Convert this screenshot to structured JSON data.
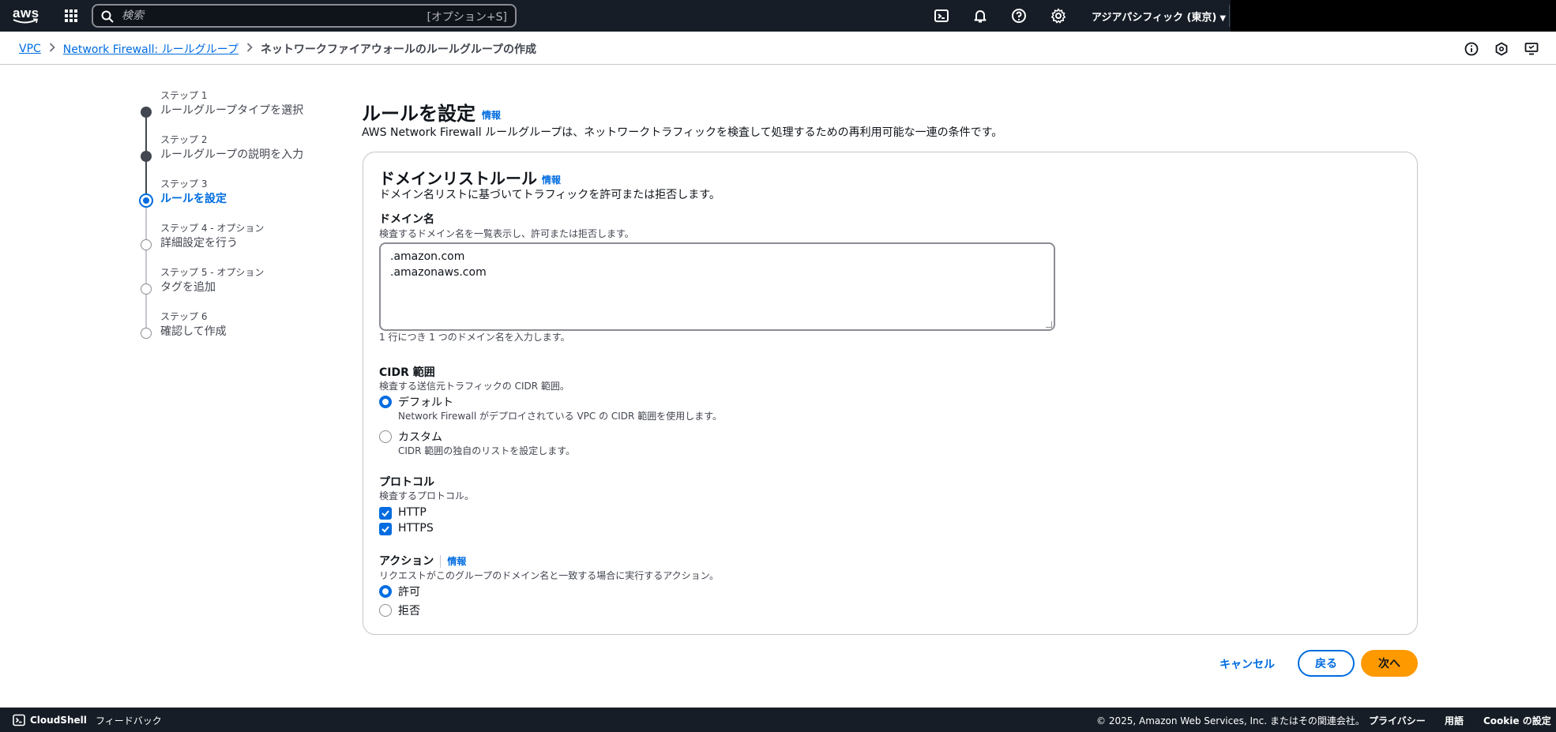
{
  "topnav": {
    "logo_text": "aws",
    "search": {
      "placeholder": "検索",
      "shortcut": "[オプション+S]"
    },
    "region": "アジアパシフィック (東京)",
    "icons": [
      "cloudshell-icon",
      "bell-icon",
      "help-icon",
      "gear-icon"
    ]
  },
  "breadcrumb": {
    "items": [
      "VPC",
      "Network Firewall: ルールグループ"
    ],
    "current": "ネットワークファイアウォールのルールグループの作成"
  },
  "wizard": {
    "steps": [
      {
        "num": "ステップ 1",
        "title": "ルールグループタイプを選択",
        "state": "completed"
      },
      {
        "num": "ステップ 2",
        "title": "ルールグループの説明を入力",
        "state": "completed"
      },
      {
        "num": "ステップ 3",
        "title": "ルールを設定",
        "state": "current"
      },
      {
        "num": "ステップ 4 - オプション",
        "title": "詳細設定を行う",
        "state": "disabled"
      },
      {
        "num": "ステップ 5 - オプション",
        "title": "タグを追加",
        "state": "disabled"
      },
      {
        "num": "ステップ 6",
        "title": "確認して作成",
        "state": "disabled"
      }
    ]
  },
  "page": {
    "title": "ルールを設定",
    "info": "情報",
    "description": "AWS Network Firewall ルールグループは、ネットワークトラフィックを検査して処理するための再利用可能な一連の条件です。"
  },
  "container": {
    "title": "ドメインリストルール",
    "info": "情報",
    "description": "ドメイン名リストに基づいてトラフィックを許可または拒否します。",
    "domain": {
      "label": "ドメイン名",
      "description": "検査するドメイン名を一覧表示し、許可または拒否します。",
      "lines": [
        ".amazon.com",
        ".amazonaws.com"
      ],
      "constraint": "1 行につき 1 つのドメイン名を入力します。"
    },
    "cidr": {
      "label": "CIDR 範囲",
      "description": "検査する送信元トラフィックの CIDR 範囲。",
      "options": [
        {
          "label": "デフォルト",
          "description": "Network Firewall がデプロイされている VPC の CIDR 範囲を使用します。",
          "checked": true
        },
        {
          "label": "カスタム",
          "description": "CIDR 範囲の独自のリストを設定します。",
          "checked": false
        }
      ]
    },
    "protocol": {
      "label": "プロトコル",
      "description": "検査するプロトコル。",
      "options": [
        {
          "label": "HTTP",
          "checked": true
        },
        {
          "label": "HTTPS",
          "checked": true
        }
      ]
    },
    "action": {
      "label": "アクション",
      "info": "情報",
      "description": "リクエストがこのグループのドメイン名と一致する場合に実行するアクション。",
      "options": [
        {
          "label": "許可",
          "checked": true
        },
        {
          "label": "拒否",
          "checked": false
        }
      ]
    }
  },
  "actions": {
    "cancel": "キャンセル",
    "back": "戻る",
    "next": "次へ"
  },
  "footer": {
    "cloudshell": "CloudShell",
    "feedback": "フィードバック",
    "copyright": "© 2025, Amazon Web Services, Inc. またはその関連会社。",
    "privacy": "プライバシー",
    "terms": "用語",
    "cookie": "Cookie の設定"
  },
  "colors": {
    "nav_bg": "#161d26",
    "link": "#006ce0",
    "primary_button": "#ff9900",
    "border": "#c6c6cd"
  }
}
